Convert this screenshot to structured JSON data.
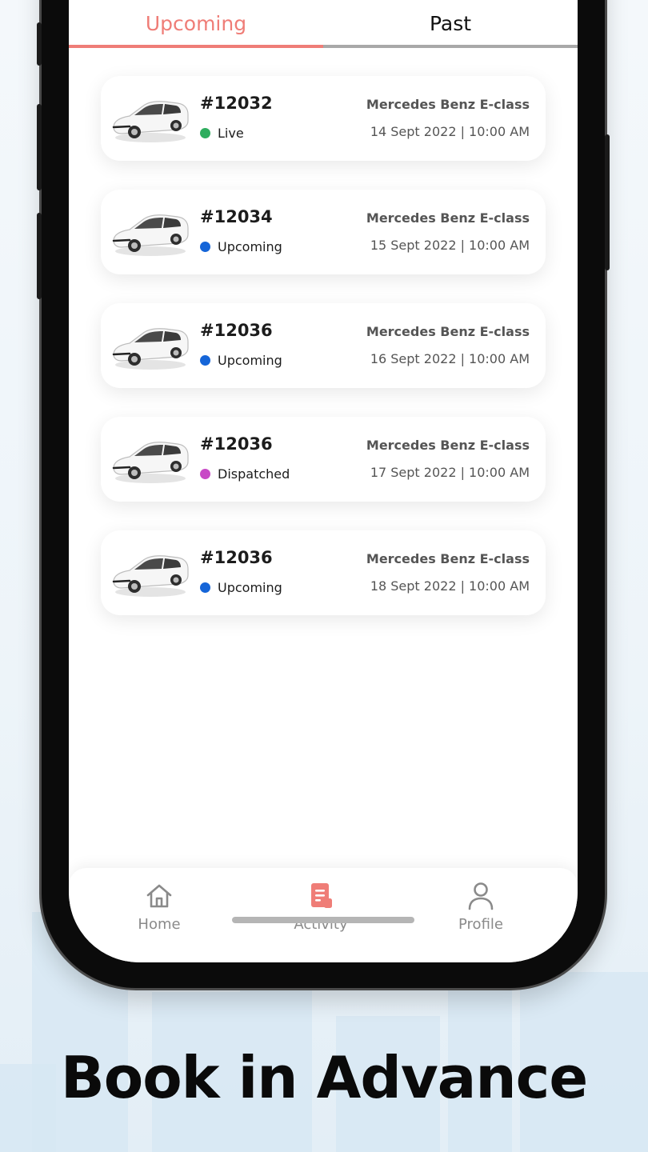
{
  "tabs": {
    "upcoming": "Upcoming",
    "past": "Past"
  },
  "bookings": [
    {
      "id": "#12032",
      "status": "Live",
      "status_color": "#2ead5e",
      "model": "Mercedes Benz E-class",
      "datetime": "14 Sept 2022 | 10:00 AM"
    },
    {
      "id": "#12034",
      "status": "Upcoming",
      "status_color": "#1565d8",
      "model": "Mercedes Benz E-class",
      "datetime": "15 Sept 2022 | 10:00 AM"
    },
    {
      "id": "#12036",
      "status": "Upcoming",
      "status_color": "#1565d8",
      "model": "Mercedes Benz E-class",
      "datetime": "16 Sept 2022 | 10:00 AM"
    },
    {
      "id": "#12036",
      "status": "Dispatched",
      "status_color": "#c849c6",
      "model": "Mercedes Benz E-class",
      "datetime": "17 Sept 2022 | 10:00 AM"
    },
    {
      "id": "#12036",
      "status": "Upcoming",
      "status_color": "#1565d8",
      "model": "Mercedes Benz E-class",
      "datetime": "18 Sept 2022 | 10:00 AM"
    }
  ],
  "nav": {
    "home": "Home",
    "activity": "Activity",
    "profile": "Profile",
    "active_color": "#ef7d77"
  },
  "headline": "Book in Advance",
  "icons": {
    "car": "car-icon",
    "home": "home-icon",
    "activity": "activity-icon",
    "profile": "profile-icon"
  }
}
